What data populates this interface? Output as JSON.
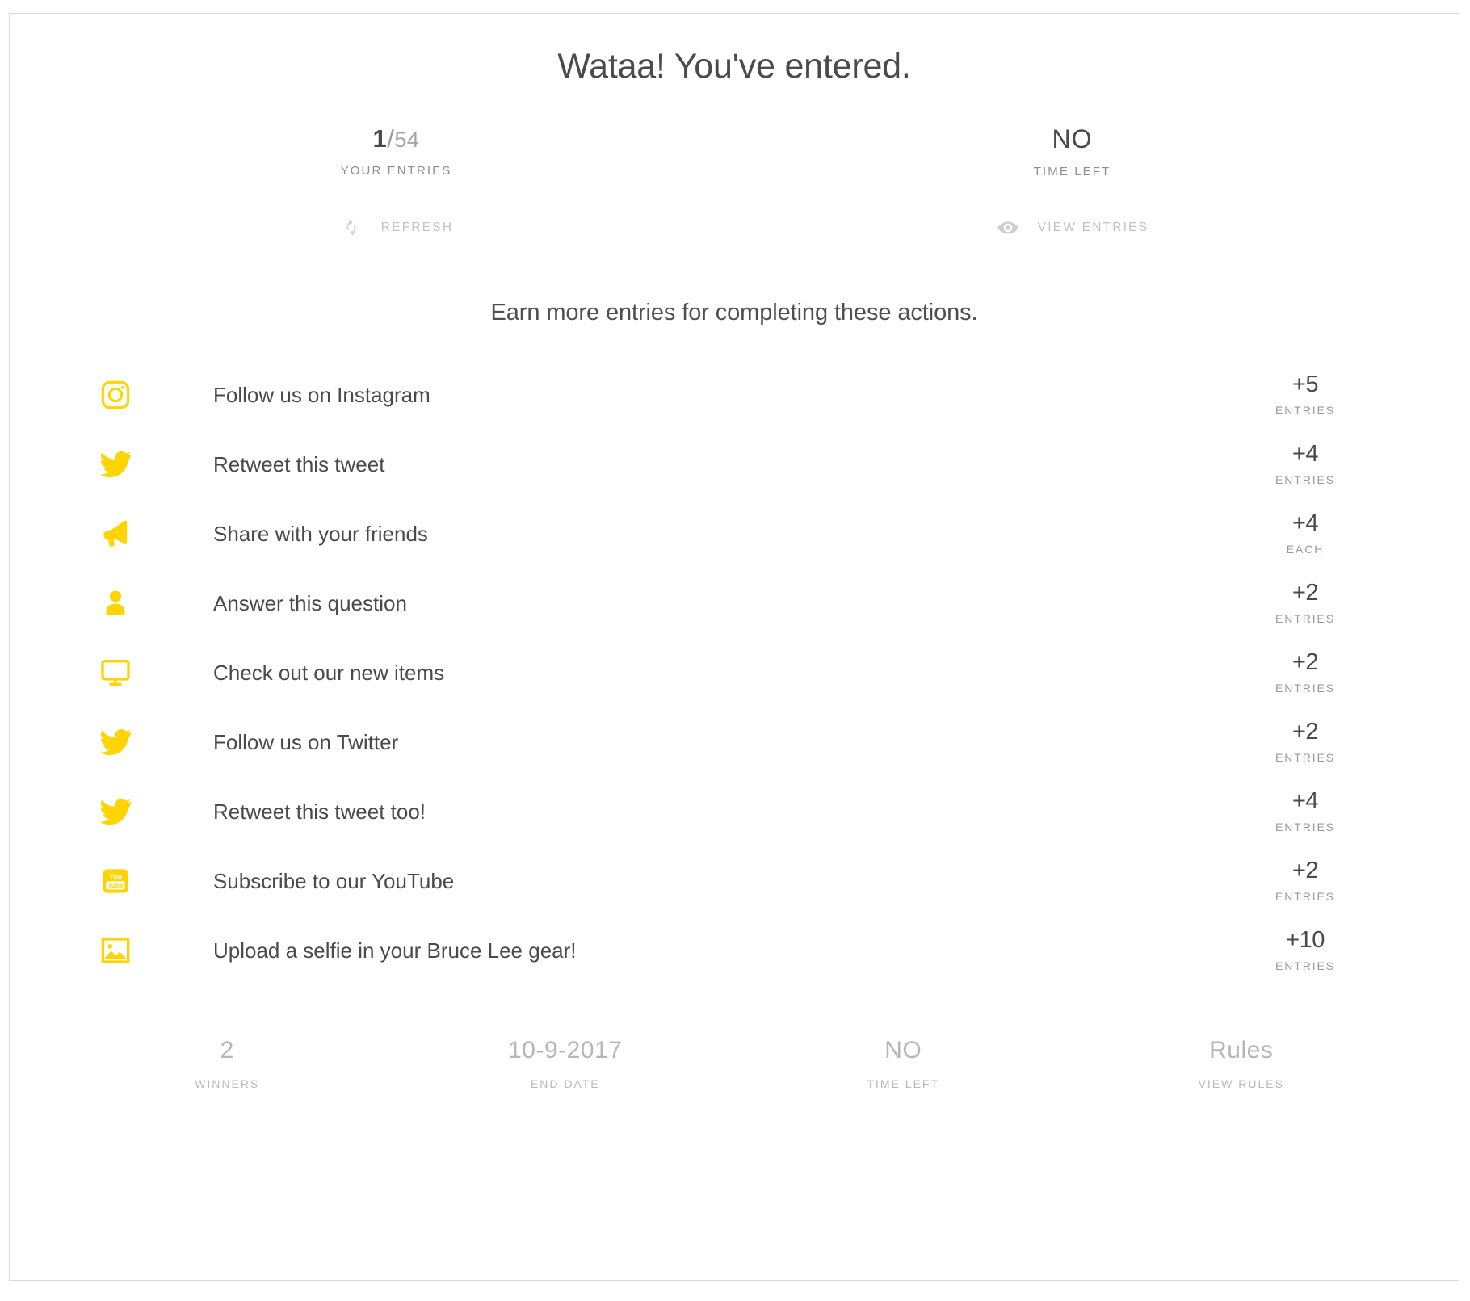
{
  "headline": "Wataa! You've entered.",
  "stats": [
    {
      "name": "your-entries",
      "value_main": "1",
      "value_slash": "/",
      "value_denom": "54",
      "label": "YOUR ENTRIES"
    },
    {
      "name": "time-left",
      "value_main": "NO",
      "label": "TIME LEFT"
    }
  ],
  "links": [
    {
      "name": "refresh",
      "icon": "refresh-icon",
      "label": "REFRESH"
    },
    {
      "name": "view-entries",
      "icon": "eye-icon",
      "label": "VIEW ENTRIES"
    }
  ],
  "section_subtitle": "Earn more entries for completing these actions.",
  "accent_color": "#FFD400",
  "actions": [
    {
      "icon": "instagram-icon",
      "label": "Follow us on Instagram",
      "amount": "+5",
      "unit": "ENTRIES"
    },
    {
      "icon": "twitter-icon",
      "label": "Retweet this tweet",
      "amount": "+4",
      "unit": "ENTRIES"
    },
    {
      "icon": "megaphone-icon",
      "label": "Share with your friends",
      "amount": "+4",
      "unit": "EACH"
    },
    {
      "icon": "person-icon",
      "label": "Answer this question",
      "amount": "+2",
      "unit": "ENTRIES"
    },
    {
      "icon": "monitor-icon",
      "label": "Check out our new items",
      "amount": "+2",
      "unit": "ENTRIES"
    },
    {
      "icon": "twitter-icon",
      "label": "Follow us on Twitter",
      "amount": "+2",
      "unit": "ENTRIES"
    },
    {
      "icon": "twitter-icon",
      "label": "Retweet this tweet too!",
      "amount": "+4",
      "unit": "ENTRIES"
    },
    {
      "icon": "youtube-icon",
      "label": "Subscribe to our YouTube",
      "amount": "+2",
      "unit": "ENTRIES"
    },
    {
      "icon": "photo-icon",
      "label": "Upload a selfie in your Bruce Lee gear!",
      "amount": "+10",
      "unit": "ENTRIES"
    }
  ],
  "footer": [
    {
      "name": "winners",
      "value": "2",
      "label": "WINNERS"
    },
    {
      "name": "end-date",
      "value": "10-9-2017",
      "label": "END DATE"
    },
    {
      "name": "time-left",
      "value": "NO",
      "label": "TIME LEFT"
    },
    {
      "name": "view-rules",
      "value": "Rules",
      "label": "VIEW RULES"
    }
  ]
}
